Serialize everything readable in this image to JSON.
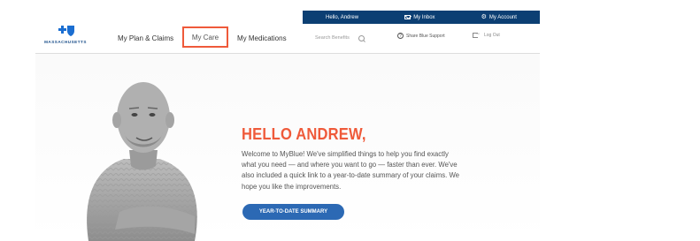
{
  "utility_bar": {
    "greeting": "Hello, Andrew",
    "inbox_label": "My Inbox",
    "account_label": "My Account"
  },
  "brand": {
    "name": "MASSACHUSETTS"
  },
  "nav": {
    "plan_claims": "My Plan & Claims",
    "care": "My Care",
    "medications": "My Medications"
  },
  "search": {
    "placeholder": "Search Benefits"
  },
  "support": {
    "label": "Share Blue Support"
  },
  "logout": {
    "label": "Log Out"
  },
  "hero": {
    "title": "HELLO ANDREW,",
    "message": "Welcome to MyBlue! We've simplified things to help you find exactly what you need — and where you want to go — faster than ever. We've also included a quick link to a year-to-date summary of your claims. We hope you like the improvements.",
    "cta_label": "YEAR-TO-DATE SUMMARY"
  },
  "colors": {
    "util_bar_bg": "#0c3f73",
    "accent_orange": "#ef5a3a",
    "cta_blue": "#2c69b4",
    "brand_blue": "#1b4f8a"
  }
}
